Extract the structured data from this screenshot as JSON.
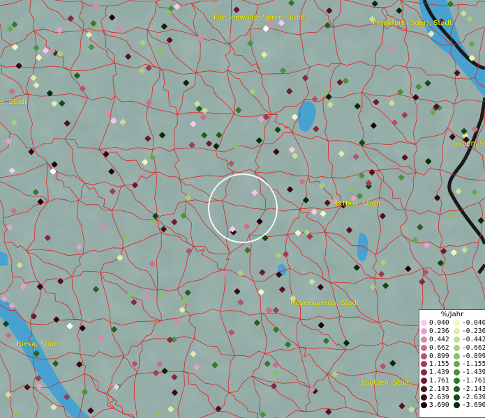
{
  "cities": [
    {
      "name": "Fürstenwalde/Spree, Stadt",
      "pos": "top-center"
    },
    {
      "name": "Frankfurt (Oder), Stadt",
      "pos": "top-right"
    },
    {
      "name": "e, Stadt",
      "pos": "left-edge"
    },
    {
      "name": "Guben, St",
      "pos": "right-edge"
    },
    {
      "name": "Cottbus, Stadt",
      "pos": "center-right"
    },
    {
      "name": "Hoyerswerda, Stadt",
      "pos": "lower-center"
    },
    {
      "name": "Riesa, Stadt",
      "pos": "lower-left"
    },
    {
      "name": "Bautzen, Stadt",
      "pos": "bottom-right"
    }
  ],
  "legend": {
    "title": "%/Jahr",
    "positive": [
      "0.040",
      "0.236",
      "0.442",
      "0.662",
      "0.899",
      "1.155",
      "1.439",
      "1.761",
      "2.143",
      "2.639",
      "3.690"
    ],
    "negative": [
      "-0.040",
      "-0.236",
      "-0.442",
      "-0.662",
      "-0.899",
      "-1.155",
      "-1.439",
      "-1.761",
      "-2.143",
      "-2.639",
      "-3.690"
    ],
    "positive_colors": [
      "#f8c8ea",
      "#e9a0c8",
      "#d98aa8",
      "#c7708c",
      "#b25470",
      "#9a3e58",
      "#822a42",
      "#6a1a30",
      "#521020",
      "#3a0814",
      "#220008"
    ],
    "negative_colors": [
      "#f4f6c2",
      "#e0ecaa",
      "#c8e094",
      "#a8d07c",
      "#88c066",
      "#68a852",
      "#4c9040",
      "#347830",
      "#226020",
      "#144814",
      "#062a08"
    ]
  },
  "colors": {
    "map_background": "#8fa8a2",
    "boundary": "#e02020",
    "water": "#3aa0d8",
    "border_dark": "#1a1a1a"
  },
  "selection_ring": "circle-selection"
}
